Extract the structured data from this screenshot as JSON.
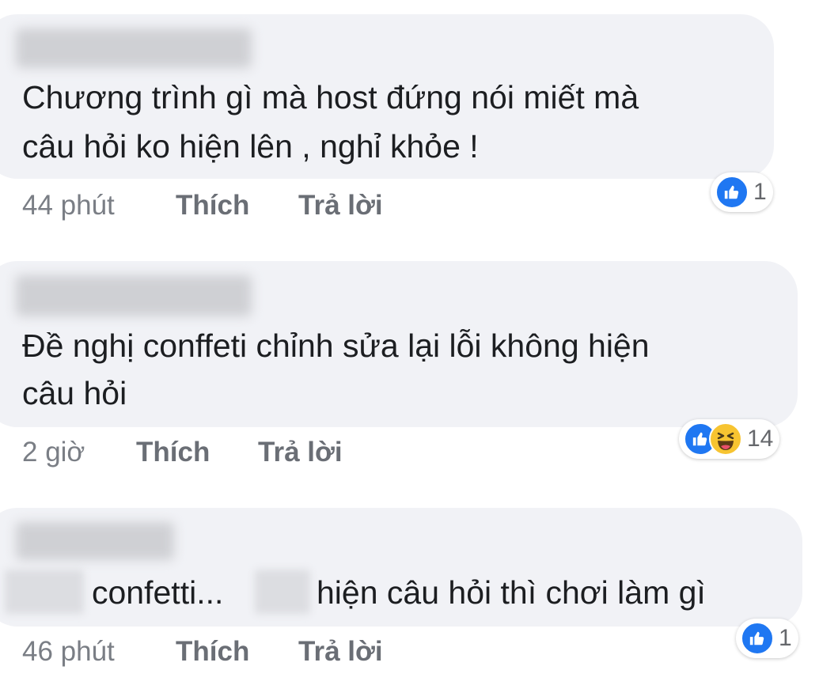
{
  "comments": [
    {
      "text_lines": [
        "Chương trình gì mà host đứng nói miết mà",
        "câu hỏi ko hiện lên , nghỉ khỏe !"
      ],
      "time": "44 phút",
      "like_label": "Thích",
      "reply_label": "Trả lời",
      "reactions": {
        "icons": [
          "like-icon"
        ],
        "count": "1"
      }
    },
    {
      "text_lines": [
        "Đề nghị conffeti chỉnh sửa lại lỗi không hiện",
        "câu hỏi"
      ],
      "time": "2 giờ",
      "like_label": "Thích",
      "reply_label": "Trả lời",
      "reactions": {
        "icons": [
          "like-icon",
          "haha-icon"
        ],
        "count": "14"
      }
    },
    {
      "text_parts": [
        "confetti...",
        "hiện câu hỏi thì chơi làm gì"
      ],
      "time": "46 phút",
      "like_label": "Thích",
      "reply_label": "Trả lời",
      "reactions": {
        "icons": [
          "like-icon"
        ],
        "count": "1"
      }
    }
  ],
  "colors": {
    "bubble": "#f1f2f6",
    "like_blue": "#1f77f2",
    "haha_yellow": "#f7c431",
    "meta_text": "#65676b"
  }
}
